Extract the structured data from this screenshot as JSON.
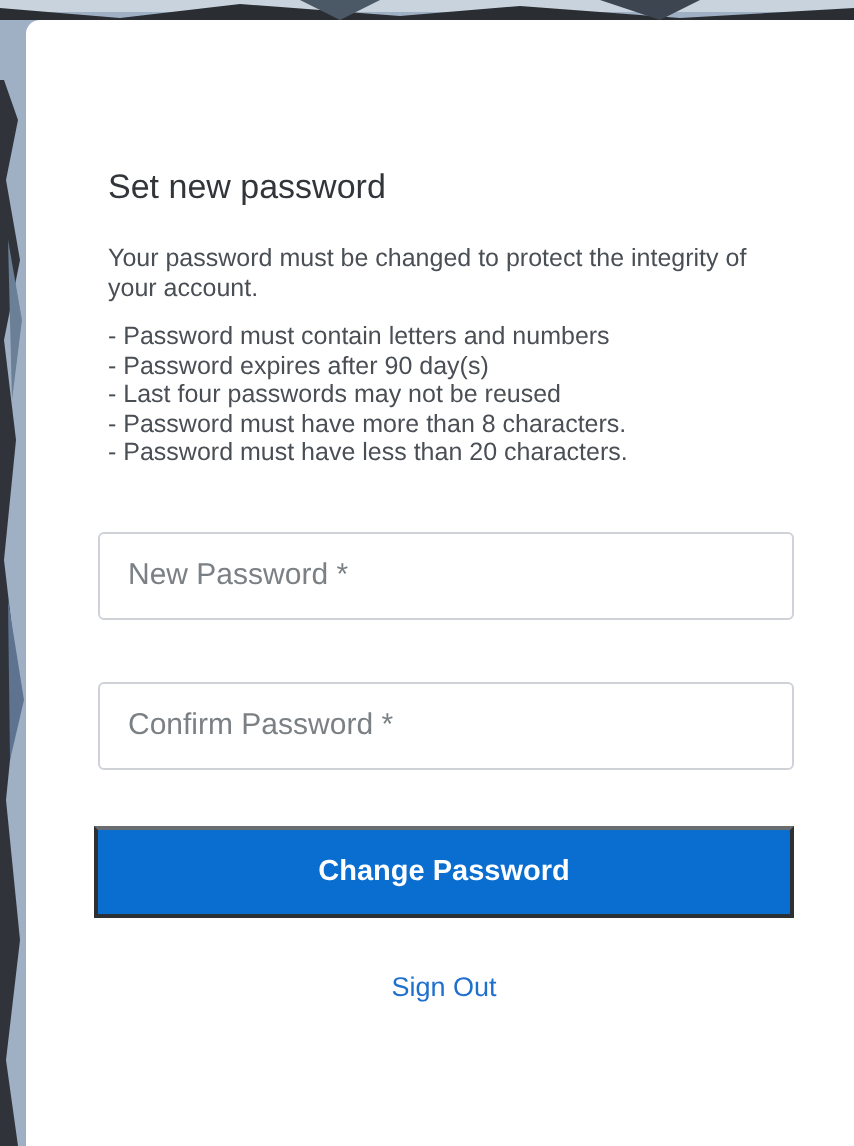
{
  "title": "Set new password",
  "intro": "Your password must be changed to protect the integrity of your account.",
  "rules": [
    "- Password must contain letters and numbers",
    "- Password expires after 90 day(s)",
    "- Last four passwords may not be reused",
    "- Password must have more than 8 characters.",
    "- Password must have less than 20 characters."
  ],
  "fields": [
    {
      "placeholder": "New Password *"
    },
    {
      "placeholder": "Confirm Password *"
    }
  ],
  "submit_button": "Change Password",
  "sign_out_link": "Sign Out"
}
